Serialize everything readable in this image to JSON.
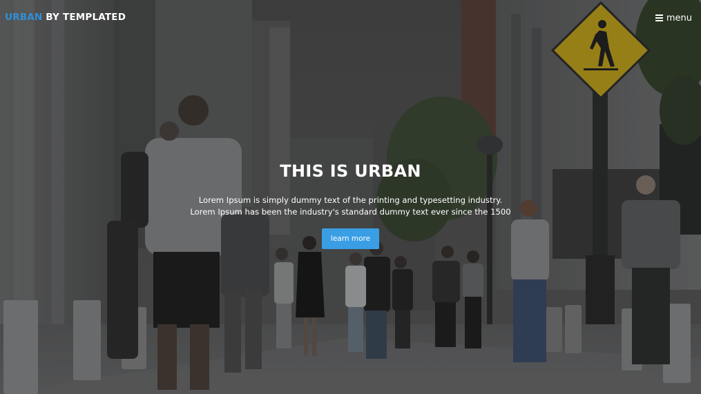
{
  "header": {
    "logo_brand": "URBAN",
    "logo_rest": " BY TEMPLATED",
    "menu_label": "menu"
  },
  "banner": {
    "title": "THIS IS URBAN",
    "description_line1": "Lorem Ipsum is simply dummy text of the printing and typesetting industry.",
    "description_line2": "Lorem Ipsum has been the industry's standard dummy text ever since the 1500",
    "button_label": "learn more"
  },
  "icons": {
    "menu": "hamburger-icon",
    "sign": "pedestrian-crossing-sign"
  },
  "colors": {
    "brand_accent": "#2f8fd8",
    "button_bg": "#3a9ee4",
    "text": "#ffffff",
    "sign_yellow": "#e6c21a"
  }
}
